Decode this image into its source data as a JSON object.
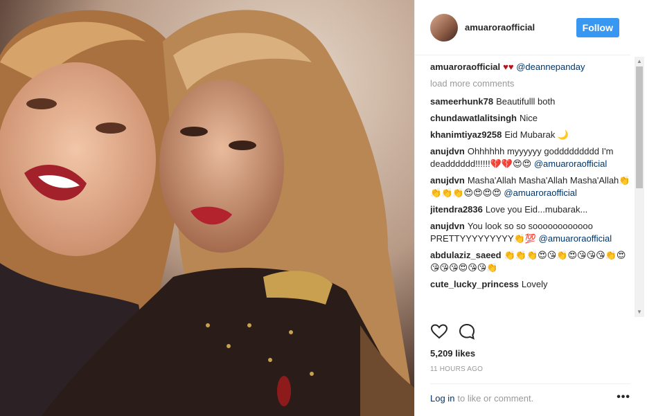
{
  "header": {
    "username": "amuaroraofficial",
    "follow_label": "Follow"
  },
  "caption": {
    "username": "amuaroraofficial",
    "hearts": "♥♥",
    "mention": "@deannepanday"
  },
  "load_more": "load more comments",
  "comments": [
    {
      "username": "sameerhunk78",
      "text": "Beautifulll both",
      "mention": ""
    },
    {
      "username": "chundawatlalitsingh",
      "text": "Nice",
      "mention": ""
    },
    {
      "username": "khanimtiyaz9258",
      "text": "Eid Mubarak 🌙",
      "mention": ""
    },
    {
      "username": "anujdvn",
      "text": "Ohhhhhh myyyyyy goddddddddd I'm deadddddd!!!!!!💔💔😍😍",
      "mention": "@amuaroraofficial"
    },
    {
      "username": "anujdvn",
      "text": "Masha'Allah Masha'Allah Masha'Allah👏👏👏👏😍😍😍😍",
      "mention": "@amuaroraofficial"
    },
    {
      "username": "jitendra2836",
      "text": "Love you Eid...mubarak...",
      "mention": ""
    },
    {
      "username": "anujdvn",
      "text": "You look so so soooooooooooo PRETTYYYYYYYYY👏💯",
      "mention": "@amuaroraofficial"
    },
    {
      "username": "abdulaziz_saeed",
      "text": "👏👏👏😍😘👏😍😘😘😘👏😍😘😘😘😍😘😘👏",
      "mention": ""
    },
    {
      "username": "cute_lucky_princess",
      "text": "Lovely",
      "mention": ""
    }
  ],
  "likes": "5,209 likes",
  "timestamp": "11 HOURS AGO",
  "footer": {
    "login": "Log in",
    "rest": "to like or comment.",
    "more": "•••"
  },
  "icons": {
    "like": "heart-icon",
    "comment": "comment-bubble-icon"
  },
  "colors": {
    "follow": "#3897f0",
    "link": "#003569",
    "muted": "#999999"
  }
}
